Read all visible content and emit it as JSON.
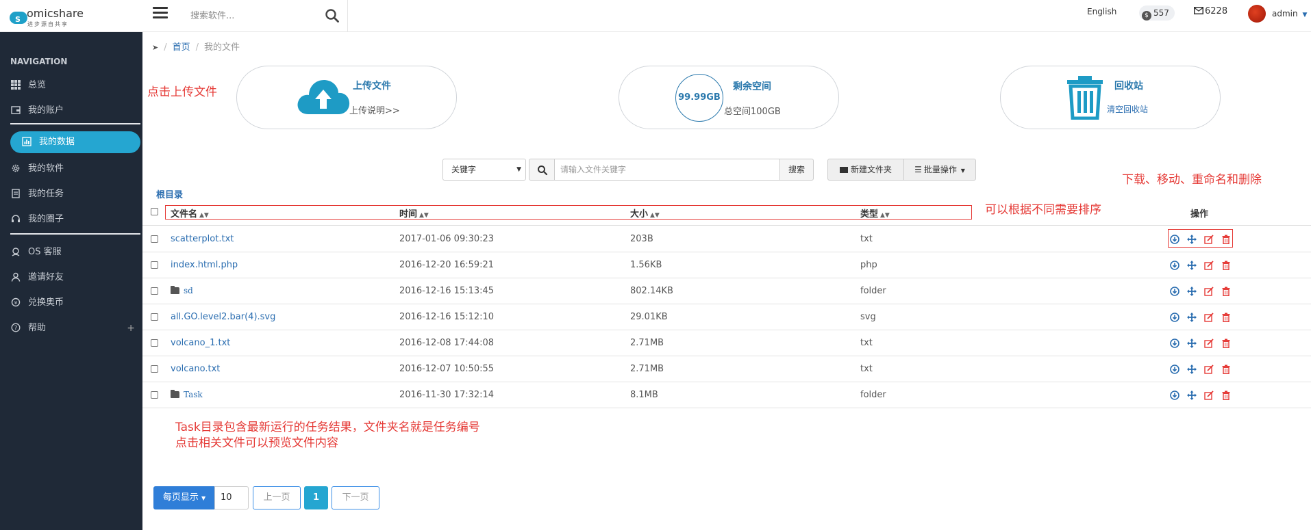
{
  "topbar": {
    "logo_name": "omicshare",
    "logo_sub": "进步源自共享",
    "search_placeholder": "搜索软件...",
    "language": "English",
    "coins": "557",
    "messages": "6228",
    "user": "admin"
  },
  "sidebar": {
    "title": "NAVIGATION",
    "items": [
      {
        "label": "总览",
        "icon": "grid-icon"
      },
      {
        "label": "我的账户",
        "icon": "wallet-icon"
      },
      {
        "label": "我的数据",
        "icon": "chart-icon"
      },
      {
        "label": "我的软件",
        "icon": "gear-icon"
      },
      {
        "label": "我的任务",
        "icon": "task-icon"
      },
      {
        "label": "我的圈子",
        "icon": "headset-icon"
      },
      {
        "label": "OS 客服",
        "icon": "support-icon"
      },
      {
        "label": "邀请好友",
        "icon": "user-icon"
      },
      {
        "label": "兑换奥币",
        "icon": "exchange-icon"
      },
      {
        "label": "帮助",
        "icon": "help-icon"
      }
    ],
    "active_index": 2
  },
  "breadcrumb": {
    "home": "首页",
    "current": "我的文件"
  },
  "cards": {
    "upload": {
      "title": "上传文件",
      "link": "上传说明>>"
    },
    "space": {
      "value": "99.99GB",
      "title": "剩余空间",
      "total": "总空间100GB"
    },
    "trash": {
      "title": "回收站",
      "link": "清空回收站"
    }
  },
  "toolbar": {
    "select_value": "关键字",
    "search_placeholder": "请输入文件关键字",
    "search_button": "搜索",
    "new_folder": "新建文件夹",
    "batch": "批量操作"
  },
  "table": {
    "root": "根目录",
    "headers": {
      "name": "文件名",
      "time": "时间",
      "size": "大小",
      "type": "类型",
      "ops": "操作"
    },
    "rows": [
      {
        "name": "scatterplot.txt",
        "time": "2017-01-06 09:30:23",
        "size": "203B",
        "type": "txt",
        "folder": false
      },
      {
        "name": "index.html.php",
        "time": "2016-12-20 16:59:21",
        "size": "1.56KB",
        "type": "php",
        "folder": false
      },
      {
        "name": "sd",
        "time": "2016-12-16 15:13:45",
        "size": "802.14KB",
        "type": "folder",
        "folder": true
      },
      {
        "name": "all.GO.level2.bar(4).svg",
        "time": "2016-12-16 15:12:10",
        "size": "29.01KB",
        "type": "svg",
        "folder": false
      },
      {
        "name": "volcano_1.txt",
        "time": "2016-12-08 17:44:08",
        "size": "2.71MB",
        "type": "txt",
        "folder": false
      },
      {
        "name": "volcano.txt",
        "time": "2016-12-07 10:50:55",
        "size": "2.71MB",
        "type": "txt",
        "folder": false
      },
      {
        "name": "Task",
        "time": "2016-11-30 17:32:14",
        "size": "8.1MB",
        "type": "folder",
        "folder": true
      }
    ]
  },
  "annotations": {
    "upload": "点击上传文件",
    "ops": "下载、移动、重命名和删除",
    "sort": "可以根据不同需要排序",
    "task_line1": "Task目录包含最新运行的任务结果，文件夹名就是任务编号",
    "task_line2": "点击相关文件可以预览文件内容"
  },
  "pager": {
    "per_page_label": "每页显示",
    "per_page_value": "10",
    "prev": "上一页",
    "current": "1",
    "next": "下一页"
  },
  "colors": {
    "accent": "#25a6d1",
    "link": "#2a6db0",
    "sidebar": "#1f2937",
    "annotation": "#e53935",
    "delete": "#e53935"
  }
}
